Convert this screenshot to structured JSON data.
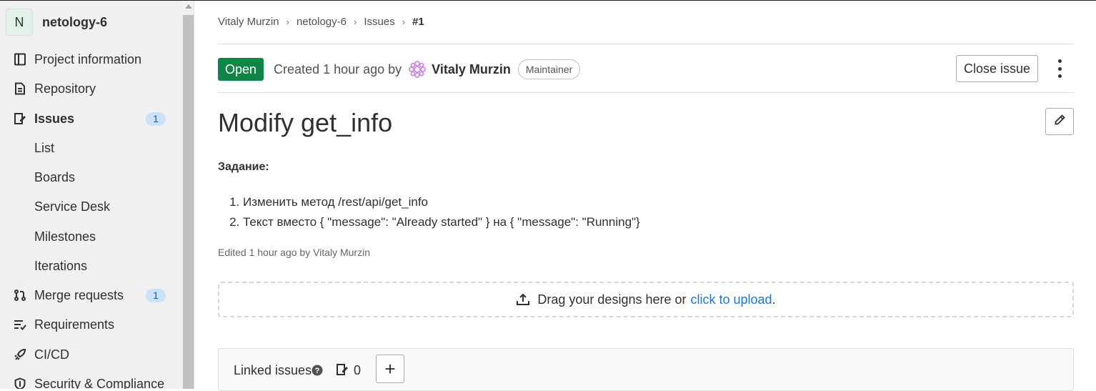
{
  "sidebar": {
    "project_avatar_letter": "N",
    "project_name": "netology-6",
    "items": [
      {
        "label": "Project information",
        "icon": "book-icon"
      },
      {
        "label": "Repository",
        "icon": "document-icon"
      },
      {
        "label": "Issues",
        "icon": "issues-icon",
        "count": "1"
      },
      {
        "label": "Merge requests",
        "icon": "merge-request-icon",
        "count": "1"
      },
      {
        "label": "Requirements",
        "icon": "requirements-icon"
      },
      {
        "label": "CI/CD",
        "icon": "rocket-icon"
      },
      {
        "label": "Security & Compliance",
        "icon": "shield-icon"
      }
    ],
    "issues_subitems": [
      "List",
      "Boards",
      "Service Desk",
      "Milestones",
      "Iterations"
    ]
  },
  "breadcrumb": [
    "Vitaly Murzin",
    "netology-6",
    "Issues",
    "#1"
  ],
  "issue": {
    "status": "Open",
    "created_text": "Created 1 hour ago by",
    "author": "Vitaly Murzin",
    "role": "Maintainer",
    "close_label": "Close issue",
    "title": "Modify get_info",
    "description_heading": "Задание:",
    "description_items": [
      "Изменить метод /rest/api/get_info",
      "Текст вместо { \"message\": \"Already started\" } на { \"message\": \"Running\"}"
    ],
    "edited_text": "Edited 1 hour ago by Vitaly Murzin"
  },
  "designs": {
    "text": "Drag your designs here or",
    "link": "click to upload",
    "suffix": "."
  },
  "linked_issues": {
    "title": "Linked issues",
    "count": "0",
    "add_label": "+"
  },
  "colors": {
    "open_badge": "#108548",
    "link": "#1f75cb",
    "count_badge_bg": "#cbe2f9",
    "active_nav": "#303030"
  }
}
